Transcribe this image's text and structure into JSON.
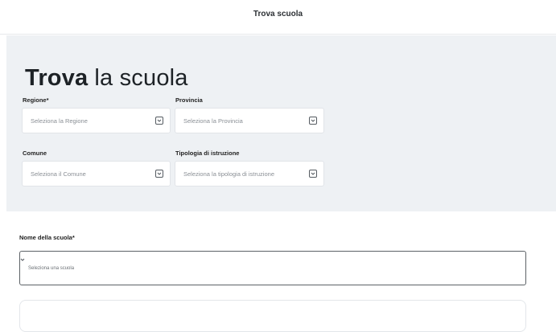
{
  "header": {
    "title": "Trova scuola"
  },
  "search": {
    "heading_strong": "Trova",
    "heading_rest": "la scuola",
    "regione": {
      "label": "Regione*",
      "placeholder": "Seleziona la Regione"
    },
    "provincia": {
      "label": "Provincia",
      "placeholder": "Seleziona la Provincia"
    },
    "comune": {
      "label": "Comune",
      "placeholder": "Seleziona il Comune"
    },
    "tipologia": {
      "label": "Tipologia di istruzione",
      "placeholder": "Seleziona la tipologia di istruzione"
    }
  },
  "school": {
    "label": "Nome della scuola*",
    "placeholder": "Seleziona una scuola"
  },
  "icons": {
    "dropdown": "chevron-down-icon"
  },
  "colors": {
    "panel_bg": "#eef1f4",
    "border": "#e1e4e8"
  }
}
